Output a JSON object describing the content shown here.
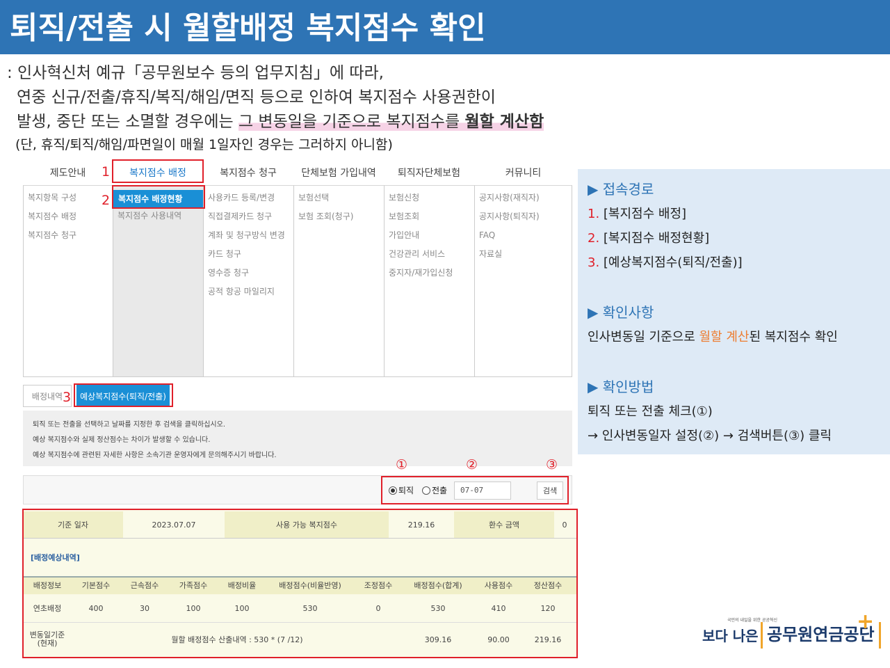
{
  "title": "퇴직/전출 시 월할배정 복지점수 확인",
  "intro": {
    "line1": ": 인사혁신처 예규「공무원보수 등의 업무지침」에 따라,",
    "line2": "연중 신규/전출/휴직/복직/해임/면직 등으로 인하여 복지점수 사용권한이",
    "line3a": "발생, 중단 또는 소멸할 경우에는 ",
    "line3b": "그 변동일을 기준으로 복지점수를 ",
    "line3c": "월할 계산함",
    "line4": "(단, 휴직/퇴직/해임/파면일이 매월 1일자인 경우는 그러하지 아니함)"
  },
  "menu": {
    "heads": [
      "제도안내",
      "복지점수 배정",
      "복지점수 청구",
      "단체보험 가입내역",
      "퇴직자단체보험",
      "커뮤니티"
    ],
    "col1": [
      "복지항목 구성",
      "복지점수 배정",
      "복지점수 청구"
    ],
    "col2": [
      "복지점수 배정현황",
      "복지점수 사용내역"
    ],
    "col3": [
      "사용카드 등록/변경",
      "직접결제카드 청구",
      "계좌 및 청구방식 변경",
      "카드 청구",
      "영수증 청구",
      "공적 항공 마일리지"
    ],
    "col4": [
      "보험선택",
      "보험 조회(청구)"
    ],
    "col5": [
      "보험신청",
      "보험조회",
      "가입안내",
      "건강관리 서비스",
      "중지자/재가입신청"
    ],
    "col6": [
      "공지사항(재직자)",
      "공지사항(퇴직자)",
      "FAQ",
      "자료실"
    ]
  },
  "markers": {
    "m1": "1",
    "m2": "2",
    "m3": "3",
    "c1": "①",
    "c2": "②",
    "c3": "③"
  },
  "tabs": {
    "tab1": "배정내역",
    "tab2": "예상복지점수(퇴직/전출)"
  },
  "notice": [
    "퇴직 또는 전출을 선택하고 날짜를 지정한 후 검색을 클릭하십시오.",
    "예상 복지점수와 실제 정산점수는 차이가 발생할 수 있습니다.",
    "예상 복지점수에 관련된 자세한 사항은 소속기관 운영자에게 문의해주시기 바랍니다."
  ],
  "search": {
    "opt1": "퇴직",
    "opt2": "전출",
    "date": "07-07",
    "button": "검색"
  },
  "summary": {
    "base_date_label": "기준 일자",
    "base_date": "2023.07.07",
    "avail_label": "사용 가능 복지점수",
    "avail": "219.16",
    "refund_label": "환수 금액",
    "refund": "0"
  },
  "section": "[배정예상내역]",
  "table": {
    "headers": [
      "배정정보",
      "기본점수",
      "근속점수",
      "가족점수",
      "배정비율",
      "배정점수(비율반영)",
      "조정점수",
      "배정점수(합계)",
      "사용점수",
      "정산점수"
    ],
    "row1": [
      "연초배정",
      "400",
      "30",
      "100",
      "100",
      "530",
      "0",
      "530",
      "410",
      "120"
    ],
    "row2_label": "변동일기준\n(현재)",
    "row2_calc": "월할 배정점수 산출내역 : 530 * (7 /12)",
    "row2_vals": [
      "309.16",
      "90.00",
      "219.16"
    ]
  },
  "side": {
    "h1": "▶ 접속경로",
    "p1n": "1.",
    "p1": " [복지점수 배정]",
    "p2n": "2.",
    "p2": " [복지점수 배정현황]",
    "p3n": "3.",
    "p3": " [예상복지점수(퇴직/전출)]",
    "h2": "▶ 확인사항",
    "c_a": "인사변동일 기준으로 ",
    "c_b": "월할 계산",
    "c_c": "된 복지점수 확인",
    "h3": "▶ 확인방법",
    "m1": "퇴직 또는 전출 체크(①)",
    "m2": "→ 인사변동일자 설정(②) → 검색버튼(③) 클릭"
  },
  "logo": {
    "tagline": "국민의 내일을 위한 공공혁신",
    "slogan": "보다 나은",
    "name": "공무원연금공단"
  }
}
